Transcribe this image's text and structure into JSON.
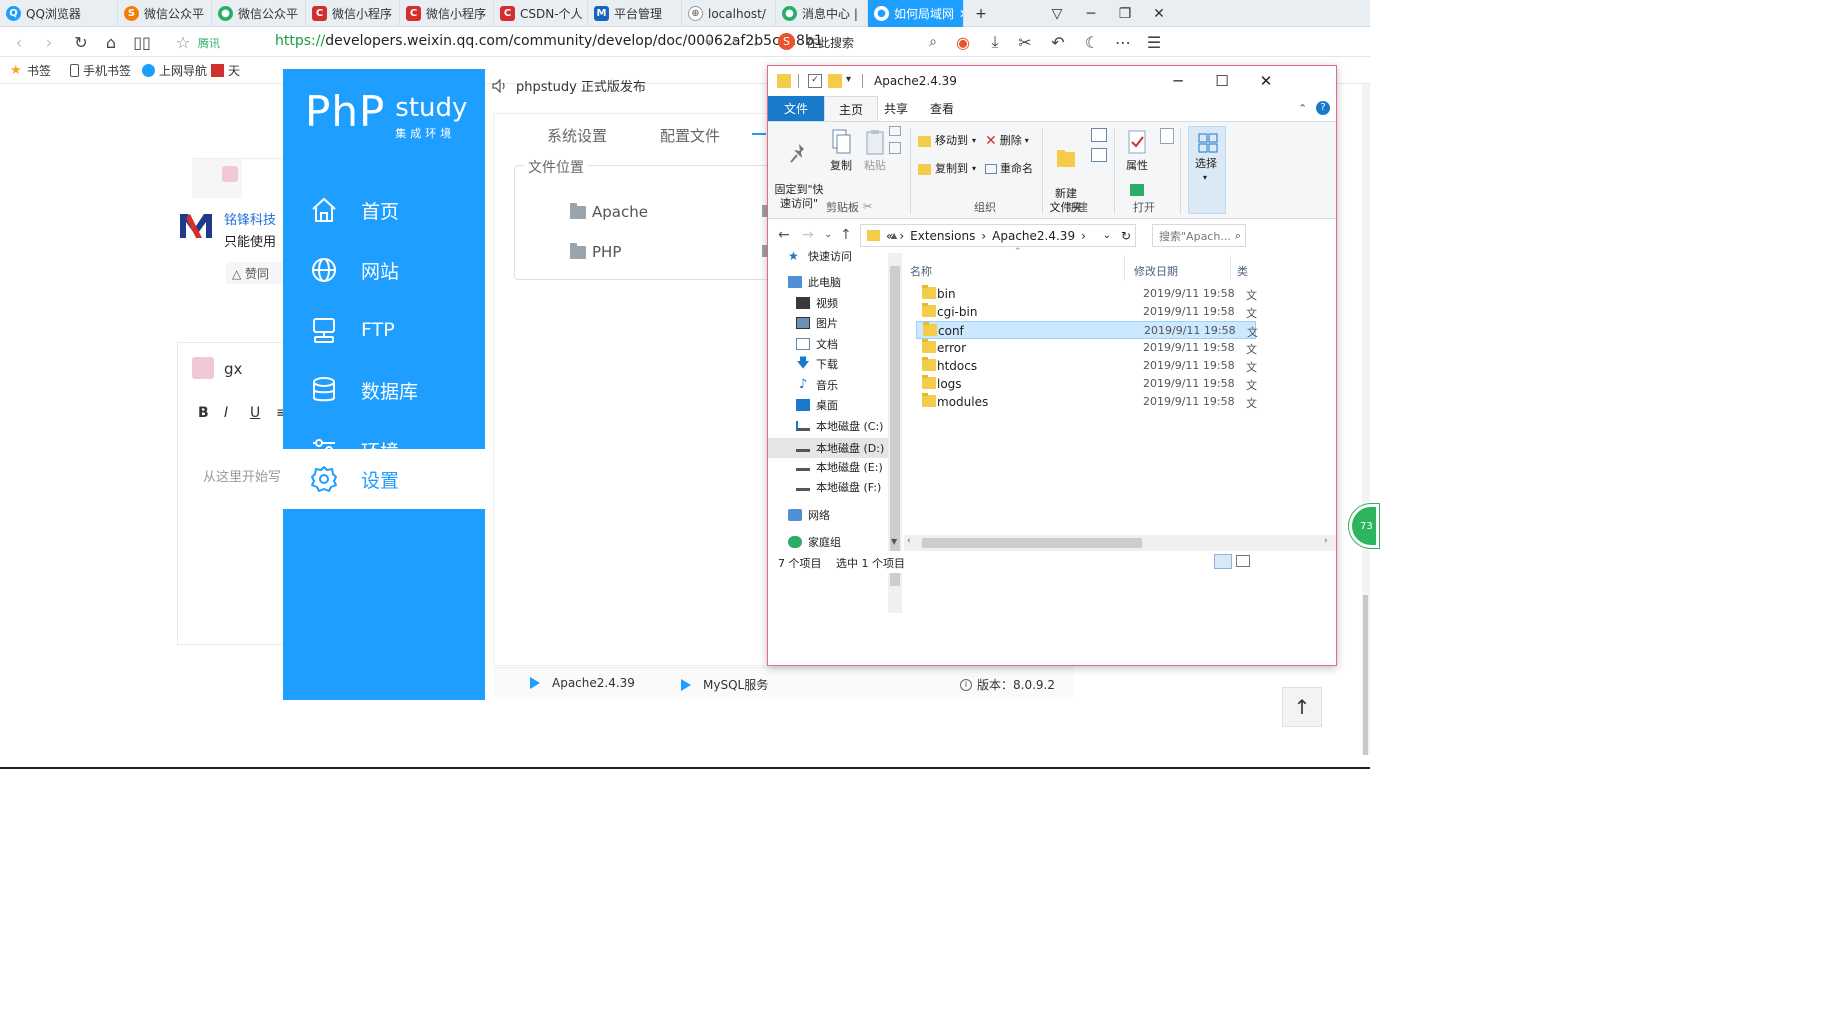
{
  "browser": {
    "tabs": [
      {
        "label": "QQ浏览器",
        "color": "#1e9fff",
        "glyph": "Q"
      },
      {
        "label": "微信公众平",
        "color": "#f57c00",
        "glyph": "S"
      },
      {
        "label": "微信公众平",
        "color": "#2aae67",
        "glyph": "●"
      },
      {
        "label": "微信小程序",
        "color": "#d32f2f",
        "glyph": "C"
      },
      {
        "label": "微信小程序",
        "color": "#d32f2f",
        "glyph": "C"
      },
      {
        "label": "CSDN-个人",
        "color": "#d32f2f",
        "glyph": "C"
      },
      {
        "label": "平台管理",
        "color": "#1565c0",
        "glyph": "M"
      },
      {
        "label": "localhost/",
        "color": "#888888",
        "glyph": "⊕"
      },
      {
        "label": "消息中心 |",
        "color": "#2aae67",
        "glyph": "●"
      },
      {
        "label": "如何局域网",
        "color": "#1e9fff",
        "glyph": "●"
      }
    ],
    "new_tab": "+",
    "tencent_label": "腾讯",
    "url_scheme": "https://",
    "url_rest": "developers.weixin.qq.com/community/develop/doc/00062af2b5cca8b1",
    "search_placeholder": "在此搜索",
    "bookmarks": [
      {
        "label": "书签",
        "color": "#f5a623"
      },
      {
        "label": "手机书签",
        "color": "#555555"
      },
      {
        "label": "上网导航",
        "color": "#1e9fff"
      },
      {
        "label": "天",
        "color": "#d32f2f"
      }
    ]
  },
  "csdn": {
    "author": "铭锋科技",
    "comment_text": "只能使用",
    "like_label": "△ 赞同",
    "user": "gx",
    "editor_buttons": [
      "B",
      "I",
      "U",
      "≡"
    ],
    "editor_placeholder": "从这里开始写"
  },
  "phpstudy": {
    "logo_big": "PhP",
    "logo_small": "study",
    "logo_cn": "集成环境",
    "announcement": "phpstudy 正式版发布",
    "nav": [
      {
        "label": "首页",
        "icon": "home-icon"
      },
      {
        "label": "网站",
        "icon": "globe-icon"
      },
      {
        "label": "FTP",
        "icon": "ftp-icon"
      },
      {
        "label": "数据库",
        "icon": "database-icon"
      },
      {
        "label": "环境",
        "icon": "sliders-icon"
      },
      {
        "label": "设置",
        "icon": "gear-icon",
        "active": true
      }
    ],
    "tabs": [
      "系统设置",
      "配置文件"
    ],
    "file_location_title": "文件位置",
    "file_locations": [
      "Apache",
      "PHP"
    ],
    "status": {
      "apache": "Apache2.4.39",
      "mysql": "MySQL服务",
      "version": "版本：8.0.9.2"
    },
    "accent": "#1e9fff"
  },
  "explorer": {
    "title": "Apache2.4.39",
    "menu_tabs": [
      "文件",
      "主页",
      "共享",
      "查看"
    ],
    "ribbon": {
      "pin": "固定到\"快\n速访问\"",
      "copy": "复制",
      "paste": "粘贴",
      "move_to": "移动到",
      "copy_to": "复制到",
      "delete": "删除",
      "rename": "重命名",
      "new_folder": "新建\n文件夹",
      "properties": "属性",
      "select": "选择",
      "groups": [
        "剪贴板",
        "组织",
        "新建",
        "打开"
      ]
    },
    "breadcrumb": [
      "«",
      "Extensions",
      "Apache2.4.39"
    ],
    "search_placeholder": "搜索\"Apach...",
    "tree": [
      {
        "label": "快速访问",
        "indent": 1,
        "icon": "star-icon"
      },
      {
        "label": "此电脑",
        "indent": 1,
        "icon": "pc-icon"
      },
      {
        "label": "视频",
        "indent": 2,
        "icon": "video-icon"
      },
      {
        "label": "图片",
        "indent": 2,
        "icon": "picture-icon"
      },
      {
        "label": "文档",
        "indent": 2,
        "icon": "document-icon"
      },
      {
        "label": "下载",
        "indent": 2,
        "icon": "download-icon"
      },
      {
        "label": "音乐",
        "indent": 2,
        "icon": "music-icon"
      },
      {
        "label": "桌面",
        "indent": 2,
        "icon": "desktop-icon"
      },
      {
        "label": "本地磁盘 (C:)",
        "indent": 2,
        "icon": "drive-c-icon"
      },
      {
        "label": "本地磁盘 (D:)",
        "indent": 2,
        "icon": "drive-icon",
        "selected": true
      },
      {
        "label": "本地磁盘 (E:)",
        "indent": 2,
        "icon": "drive-icon"
      },
      {
        "label": "本地磁盘 (F:)",
        "indent": 2,
        "icon": "drive-icon"
      },
      {
        "label": "网络",
        "indent": 1,
        "icon": "network-icon"
      },
      {
        "label": "家庭组",
        "indent": 1,
        "icon": "homegroup-icon"
      }
    ],
    "columns": {
      "name": "名称",
      "date": "修改日期",
      "type": "类"
    },
    "files": [
      {
        "name": "bin",
        "date": "2019/9/11 19:58",
        "type": "文"
      },
      {
        "name": "cgi-bin",
        "date": "2019/9/11 19:58",
        "type": "文"
      },
      {
        "name": "conf",
        "date": "2019/9/11 19:58",
        "type": "文",
        "selected": true
      },
      {
        "name": "error",
        "date": "2019/9/11 19:58",
        "type": "文"
      },
      {
        "name": "htdocs",
        "date": "2019/9/11 19:58",
        "type": "文"
      },
      {
        "name": "logs",
        "date": "2019/9/11 19:58",
        "type": "文"
      },
      {
        "name": "modules",
        "date": "2019/9/11 19:58",
        "type": "文"
      }
    ],
    "status_count": "7 个项目",
    "status_selected": "选中 1 个项目",
    "accent": "#1979ca"
  },
  "misc": {
    "badge": "73"
  }
}
